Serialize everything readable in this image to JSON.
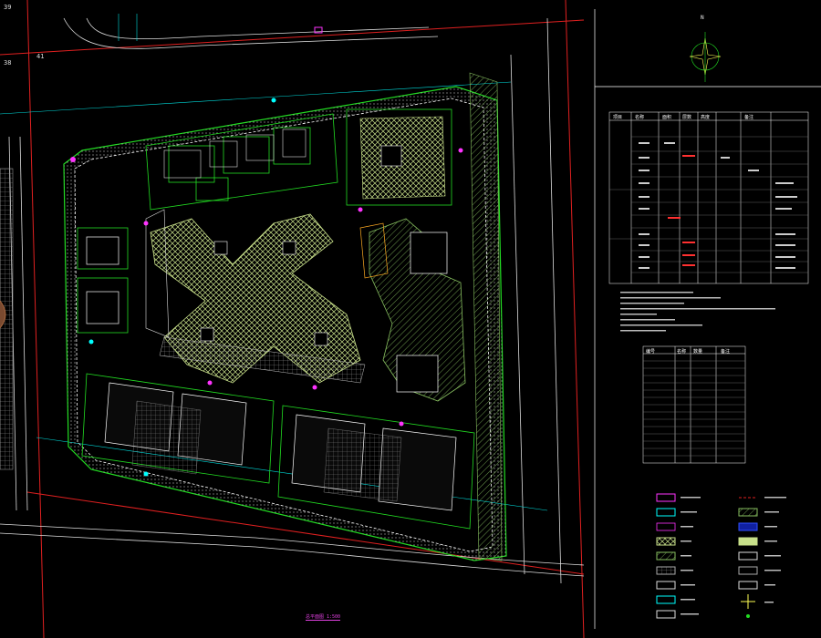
{
  "drawing": {
    "title": "总平面图 1:500",
    "north_label": "N",
    "grid_labels": [
      "39",
      "38",
      "41"
    ]
  },
  "colors": {
    "background": "#000000",
    "boundary_red": "#e02020",
    "road_white": "#ffffff",
    "green_line": "#22dd22",
    "cyan_label": "#00ffff",
    "magenta": "#ff33ff",
    "hatch_yellow": "#c8e08a",
    "hatch_green": "#88c060"
  },
  "schedule_table": {
    "headers": [
      "项目",
      "名称",
      "面积",
      "层数",
      "高度",
      "备注"
    ]
  },
  "index_table": {
    "headers": [
      "编号",
      "名称",
      "数量",
      "备注"
    ]
  },
  "legend": {
    "items_left": [
      "",
      "",
      "",
      "",
      "",
      "",
      "",
      "",
      ""
    ],
    "items_right": [
      "",
      "",
      "",
      "",
      "",
      "",
      "",
      "",
      ""
    ]
  }
}
